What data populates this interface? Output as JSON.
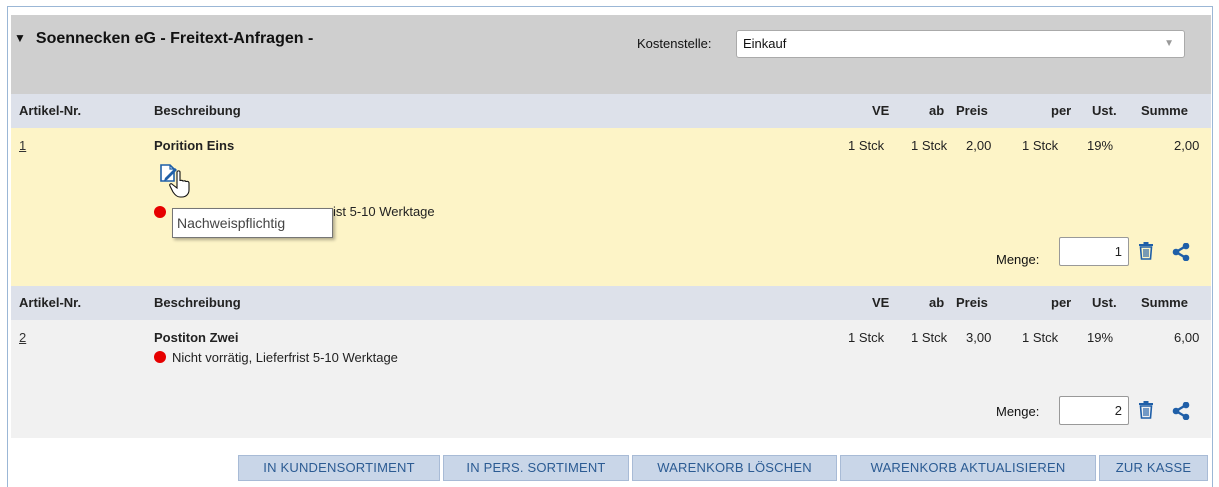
{
  "header": {
    "collapse_icon": "triangle-down-icon",
    "title": "Soennecken eG - Freitext-Anfragen -",
    "kostenstelle_label": "Kostenstelle:",
    "kostenstelle_value": "Einkauf"
  },
  "columns": {
    "nr": "Artikel-Nr.",
    "desc": "Beschreibung",
    "ve": "VE",
    "ab": "ab",
    "preis": "Preis",
    "per": "per",
    "ust": "Ust.",
    "summe": "Summe"
  },
  "items": [
    {
      "nr": "1",
      "name": "Porition Eins",
      "availability": "Nicht vorrätig, Lieferfrist 5-10 Werktage",
      "availability_visible": "ist 5-10 Werktage",
      "ve": "1 Stck",
      "ab": "1 Stck",
      "preis": "2,00",
      "per": "1 Stck",
      "ust": "19%",
      "summe": "2,00",
      "menge_label": "Menge:",
      "menge": "1",
      "edit_icon": "edit-document-icon",
      "tooltip": "Nachweispflichtig"
    },
    {
      "nr": "2",
      "name": "Postiton Zwei",
      "availability": "Nicht vorrätig, Lieferfrist 5-10 Werktage",
      "ve": "1 Stck",
      "ab": "1 Stck",
      "preis": "3,00",
      "per": "1 Stck",
      "ust": "19%",
      "summe": "6,00",
      "menge_label": "Menge:",
      "menge": "2"
    }
  ],
  "actions": {
    "kundensortiment": "IN KUNDENSORTIMENT",
    "pers_sortiment": "IN PERS. SORTIMENT",
    "loeschen": "WARENKORB LÖSCHEN",
    "aktualisieren": "WARENKORB AKTUALISIEREN",
    "kasse": "ZUR KASSE"
  },
  "colors": {
    "header_bg": "#cfcfcf",
    "column_header_bg": "#dde1ea",
    "row_highlight_bg": "#fdf4c7",
    "row_bg": "#f1f1f1",
    "accent_blue": "#2b5b93",
    "status_red": "#e60000"
  }
}
